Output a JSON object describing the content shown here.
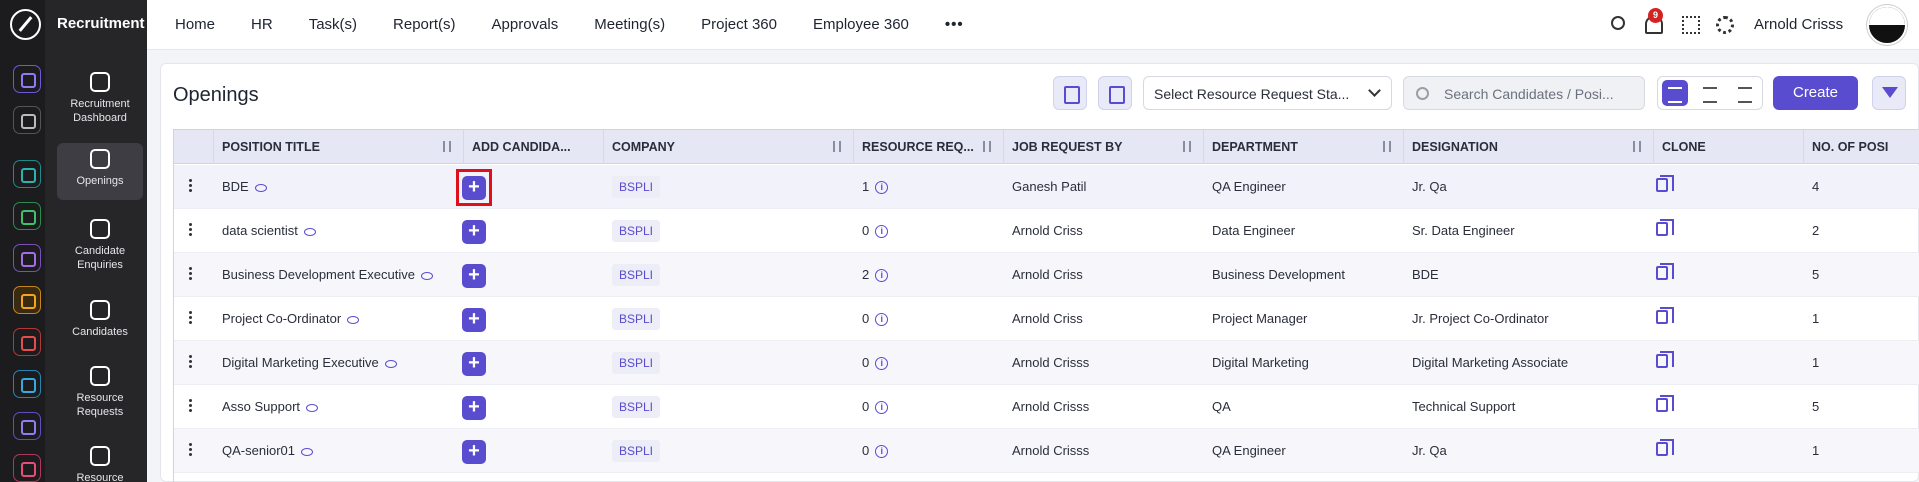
{
  "app": {
    "module_title": "Recruitment"
  },
  "sidebar": {
    "items": [
      {
        "label": "Recruitment Dashboard"
      },
      {
        "label": "Openings"
      },
      {
        "label": "Candidate Enquiries"
      },
      {
        "label": "Candidates"
      },
      {
        "label": "Resource Requests"
      },
      {
        "label": "Resource"
      }
    ]
  },
  "topnav": {
    "items": [
      "Home",
      "HR",
      "Task(s)",
      "Report(s)",
      "Approvals",
      "Meeting(s)",
      "Project 360",
      "Employee 360"
    ],
    "more": "•••",
    "notification_count": "9",
    "user_name": "Arnold Crisss"
  },
  "page": {
    "title": "Openings",
    "status_select": "Select Resource Request Sta...",
    "search_placeholder": "Search Candidates / Posi...",
    "create_label": "Create"
  },
  "table": {
    "columns": [
      "POSITION TITLE",
      "ADD CANDIDA...",
      "COMPANY",
      "RESOURCE REQ...",
      "JOB REQUEST BY",
      "DEPARTMENT",
      "DESIGNATION",
      "CLONE",
      "NO. OF POSI"
    ],
    "rows": [
      {
        "position": "BDE",
        "company": "BSPLI",
        "resource_req": "1",
        "requested_by": "Ganesh Patil",
        "department": "QA Engineer",
        "designation": "Jr. Qa",
        "positions": "4"
      },
      {
        "position": "data scientist",
        "company": "BSPLI",
        "resource_req": "0",
        "requested_by": "Arnold Criss",
        "department": "Data Engineer",
        "designation": "Sr. Data Engineer",
        "positions": "2"
      },
      {
        "position": "Business Development Executive",
        "company": "BSPLI",
        "resource_req": "2",
        "requested_by": "Arnold Criss",
        "department": "Business Development",
        "designation": "BDE",
        "positions": "5"
      },
      {
        "position": "Project Co-Ordinator",
        "company": "BSPLI",
        "resource_req": "0",
        "requested_by": "Arnold Criss",
        "department": "Project Manager",
        "designation": "Jr. Project Co-Ordinator",
        "positions": "1"
      },
      {
        "position": "Digital Marketing Executive",
        "company": "BSPLI",
        "resource_req": "0",
        "requested_by": "Arnold Crisss",
        "department": "Digital Marketing",
        "designation": "Digital Marketing Associate",
        "positions": "1"
      },
      {
        "position": "Asso Support",
        "company": "BSPLI",
        "resource_req": "0",
        "requested_by": "Arnold Crisss",
        "department": "QA",
        "designation": "Technical Support",
        "positions": "5"
      },
      {
        "position": "QA-senior01",
        "company": "BSPLI",
        "resource_req": "0",
        "requested_by": "Arnold Crisss",
        "department": "QA Engineer",
        "designation": "Jr. Qa",
        "positions": "1"
      }
    ]
  },
  "colors": {
    "accent": "#5a4ccf",
    "highlight": "#e0101a",
    "sidebar": "#262629"
  }
}
